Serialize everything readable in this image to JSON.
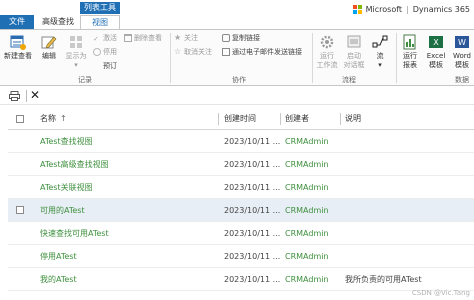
{
  "tabs": {
    "file": "文件",
    "advanced_find": "高级查找",
    "context_group": "列表工具",
    "view": "视图"
  },
  "brand": {
    "microsoft": "Microsoft",
    "separator": "|",
    "product": "Dynamics 365"
  },
  "ribbon": {
    "new_view": "新建查看",
    "edit": "编辑",
    "show_as": "显示为",
    "show_as_arrow": "▾",
    "activate": "激活",
    "deactivate": "停用",
    "schedule": "预订",
    "delete_view": "删除查看",
    "group_records": "记录",
    "follow": "关注",
    "unfollow": "取消关注",
    "copy_link": "复制链接",
    "email_link": "通过电子邮件发送链接",
    "group_collaborate": "协作",
    "run_workflow_1": "运行",
    "run_workflow_2": "工作流",
    "start_dialog_1": "启动",
    "start_dialog_2": "对话框",
    "flow": "流",
    "flow_arrow": "▾",
    "group_process": "流程",
    "run_report_1": "运行",
    "run_report_2": "报表",
    "excel_template_1": "Excel",
    "excel_template_2": "模板",
    "word_template_1": "Word",
    "word_template_2": "模板",
    "group_data": "数据"
  },
  "colors": {
    "accent": "#1f6fb5",
    "link_green": "#3d8f3d",
    "selected_row": "#e8eef5"
  },
  "grid": {
    "headers": {
      "name": "名称",
      "sort_indicator": "↑",
      "created_on": "创建时间",
      "created_by": "创建者",
      "description": "说明"
    },
    "rows": [
      {
        "name": "ATest查找视图",
        "created_on": "2023/10/11 ...",
        "created_by": "CRMAdmin",
        "description": ""
      },
      {
        "name": "ATest高级查找视图",
        "created_on": "2023/10/11 ...",
        "created_by": "CRMAdmin",
        "description": ""
      },
      {
        "name": "ATest关联视图",
        "created_on": "2023/10/11 ...",
        "created_by": "CRMAdmin",
        "description": ""
      },
      {
        "name": "可用的ATest",
        "created_on": "2023/10/11 ...",
        "created_by": "CRMAdmin",
        "description": ""
      },
      {
        "name": "快速查找可用ATest",
        "created_on": "2023/10/11 ...",
        "created_by": "CRMAdmin",
        "description": ""
      },
      {
        "name": "停用ATest",
        "created_on": "2023/10/11 ...",
        "created_by": "CRMAdmin",
        "description": ""
      },
      {
        "name": "我的ATest",
        "created_on": "2023/10/11 ...",
        "created_by": "CRMAdmin",
        "description": "我所负责的可用ATest"
      }
    ]
  },
  "watermark": "CSDN @Vic.Tang"
}
